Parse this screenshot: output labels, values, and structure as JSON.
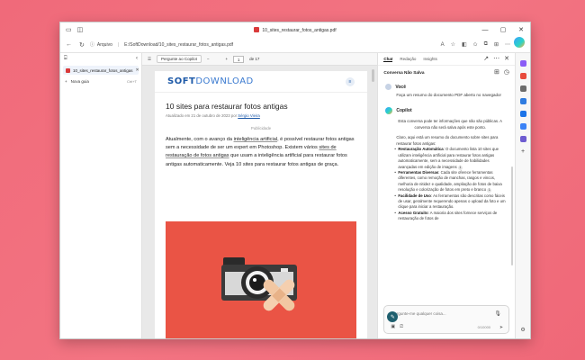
{
  "window": {
    "tab_title": "10_sites_restaurar_fotos_antigas.pdf"
  },
  "address": {
    "nav": {
      "back": "←",
      "forward": "→",
      "refresh": "↻"
    },
    "info_label": "Arquivo",
    "path": "E:/SoftDownload/10_sites_restaurar_fotos_antigas.pdf"
  },
  "left_sidebar": {
    "tab_label": "10_sites_restaurar_fotos_antigas",
    "new_tab_label": "Nova guia",
    "new_tab_shortcut": "Ctrl+T"
  },
  "pdf_toolbar": {
    "ask_copilot": "Pergunte ao Copilot",
    "zoom_out": "−",
    "current_page": "1",
    "zoom_in": "+",
    "page_total": "de 17"
  },
  "document": {
    "logo_bold": "SOFT",
    "logo_light": "DOWNLOAD",
    "title": "10 sites para restaurar fotos antigas",
    "meta_prefix": "Atualizado em 21 de outubro de 2023 por",
    "author": "Sérgio Vieira",
    "publicidade": "Publicidade",
    "body_1": "Atualmente, com o avanço da ",
    "body_link_1": "inteligência artificial",
    "body_2": ", é possível restaurar fotos antigas sem a necessidade de ser um expert em Photoshop. Existem vários ",
    "body_link_2": "sites de restauração de fotos antigas",
    "body_3": " que usam a inteligência artificial para restaurar fotos antigas automaticamente. Veja 10 sites para restaurar fotos antigas de graça."
  },
  "copilot": {
    "tabs": [
      "Chat",
      "Redação",
      "Insights"
    ],
    "conversation_title": "Conversa Não Salva",
    "user_name": "Você",
    "user_message": "Faça um resumo do documento PDF aberto no navegador",
    "ai_name": "Copilot",
    "notice": "Esta conversa pode ter informações que não são públicas. A conversa não será salva após este ponto.",
    "summary_intro": "Claro, aqui está um resumo do documento sobre sites para restaurar fotos antigas:",
    "bullets": [
      {
        "title": "Restauração Automática",
        "text": ": O documento lista 10 sites que utilizam inteligência artificial para restaurar fotos antigas automaticamente, sem a necessidade de habilidades avançadas em edição de imagens",
        "cite": "1"
      },
      {
        "title": "Ferramentas Diversas",
        "text": ": Cada site oferece ferramentas diferentes, como remoção de manchas, rasgos e vincos, melhoria de nitidez e qualidade, ampliação de fotos de baixa resolução e colorização de fotos em preto e branco",
        "cite": "1"
      },
      {
        "title": "Facilidade de Uso",
        "text": ": As ferramentas são descritas como fáceis de usar, geralmente requerendo apenas o upload da foto e um clique para iniciar a restauração.",
        "cite": ""
      },
      {
        "title": "Acesso Gratuito",
        "text": ": A maioria dos sites fornece serviços de restauração de fotos de",
        "cite": ""
      }
    ],
    "input_placeholder": "Pergunte-me qualquer coisa...",
    "char_count": "0/10000"
  },
  "colors": {
    "background": "#f06a7a",
    "hero": "#ea5445",
    "brand_blue": "#1e5aa8"
  }
}
